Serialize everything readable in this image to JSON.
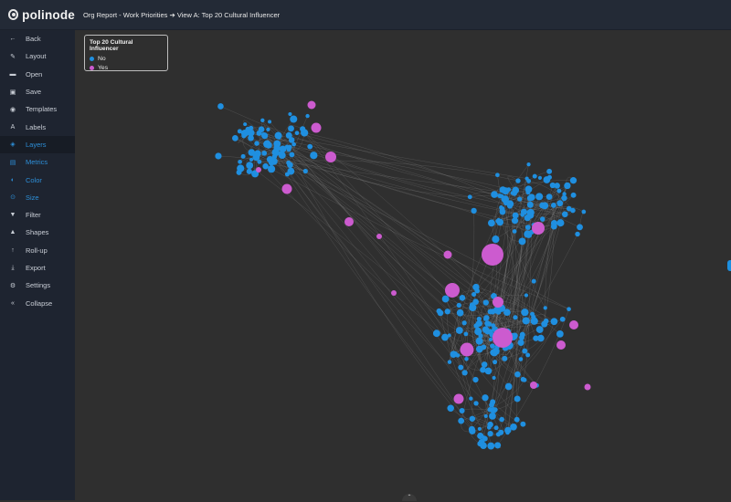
{
  "app": {
    "logo_text": "polinode"
  },
  "header": {
    "breadcrumb": "Org Report - Work Priorities ➔ View A: Top 20 Cultural Influencer"
  },
  "sidebar": {
    "items": [
      {
        "label": "Back",
        "icon": "←",
        "icon_name": "arrow-left-icon"
      },
      {
        "label": "Layout",
        "icon": "✎",
        "icon_name": "magic-wand-icon"
      },
      {
        "label": "Open",
        "icon": "▬",
        "icon_name": "folder-open-icon"
      },
      {
        "label": "Save",
        "icon": "▣",
        "icon_name": "floppy-disk-icon"
      },
      {
        "label": "Templates",
        "icon": "◉",
        "icon_name": "palette-icon"
      },
      {
        "label": "Labels",
        "icon": "A",
        "icon_name": "font-icon"
      },
      {
        "label": "Layers",
        "icon": "◈",
        "icon_name": "layers-icon"
      },
      {
        "label": "Metrics",
        "icon": "▤",
        "icon_name": "calculator-icon"
      },
      {
        "label": "Color",
        "icon": "◐",
        "icon_name": "color-drop-icon"
      },
      {
        "label": "Size",
        "icon": "⊙",
        "icon_name": "size-circle-icon"
      },
      {
        "label": "Filter",
        "icon": "▼",
        "icon_name": "filter-icon"
      },
      {
        "label": "Shapes",
        "icon": "▲",
        "icon_name": "shapes-icon"
      },
      {
        "label": "Roll-up",
        "icon": "↑",
        "icon_name": "arrow-up-icon"
      },
      {
        "label": "Export",
        "icon": "⤓",
        "icon_name": "download-icon"
      },
      {
        "label": "Settings",
        "icon": "⚙",
        "icon_name": "gear-icon"
      },
      {
        "label": "Collapse",
        "icon": "«",
        "icon_name": "double-chevron-left-icon"
      }
    ]
  },
  "legend": {
    "title": "Top 20 Cultural Influencer",
    "entries": [
      {
        "label": "No",
        "color": "#1f8fe0"
      },
      {
        "label": "Yes",
        "color": "#cc5bcf"
      }
    ]
  },
  "colors": {
    "topbar": "#232a36",
    "sidebar": "#1e2430",
    "canvas": "#2f2f2f",
    "node_no": "#1f8fe0",
    "node_yes": "#cc5bcf",
    "edge": "#8a8a8a",
    "accent": "#2d8fd8"
  }
}
